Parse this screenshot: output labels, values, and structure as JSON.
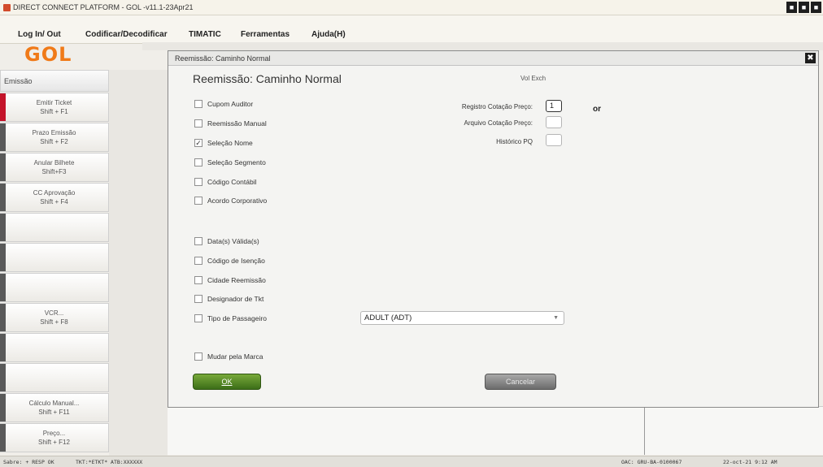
{
  "window": {
    "title": "DIRECT CONNECT PLATFORM - GOL -v11.1-23Apr21",
    "buttons": [
      "■",
      "■",
      "■"
    ]
  },
  "menu": [
    {
      "label": "Log In/ Out"
    },
    {
      "label": "Codificar/Decodificar"
    },
    {
      "label": "TIMATIC"
    },
    {
      "label": "Ferramentas"
    },
    {
      "label": "Ajuda(H)"
    }
  ],
  "logo": "GOL",
  "sidebar": {
    "header": "Emissão",
    "items": [
      {
        "label": "Emitir Ticket",
        "shortcut": "Shift + F1"
      },
      {
        "label": "Prazo Emissão",
        "shortcut": "Shift + F2"
      },
      {
        "label": "Anular Bilhete",
        "shortcut": "Shift+F3"
      },
      {
        "label": "CC Aprovação",
        "shortcut": "Shift + F4"
      },
      {
        "label": "",
        "shortcut": ""
      },
      {
        "label": "",
        "shortcut": ""
      },
      {
        "label": "",
        "shortcut": ""
      },
      {
        "label": "VCR...",
        "shortcut": "Shift + F8"
      },
      {
        "label": "",
        "shortcut": ""
      },
      {
        "label": "",
        "shortcut": ""
      },
      {
        "label": "Cálculo Manual...",
        "shortcut": "Shift + F11"
      },
      {
        "label": "Preço...",
        "shortcut": "Shift + F12"
      }
    ]
  },
  "dialog": {
    "title": "Reemissão: Caminho Normal",
    "heading": "Reemissão: Caminho Normal",
    "vol_exch": "Vol Exch",
    "close": "✖",
    "checkboxes": [
      {
        "label": "Cupom Auditor",
        "checked": false
      },
      {
        "label": "Reemissão Manual",
        "checked": false
      },
      {
        "label": "Seleção Nome",
        "checked": true
      },
      {
        "label": "Seleção Segmento",
        "checked": false
      },
      {
        "label": "Código Contábil",
        "checked": false
      },
      {
        "label": "Acordo Corporativo",
        "checked": false
      },
      {
        "label": "Data(s) Válida(s)",
        "checked": false
      },
      {
        "label": "Código de Isenção",
        "checked": false
      },
      {
        "label": "Cidade Reemissão",
        "checked": false
      },
      {
        "label": "Designador de Tkt",
        "checked": false
      },
      {
        "label": "Tipo de Passageiro",
        "checked": false
      },
      {
        "label": "Mudar pela Marca",
        "checked": false
      }
    ],
    "check_mark": "✓",
    "fields": [
      {
        "label": "Registro Cotação Preço:",
        "value": "1"
      },
      {
        "label": "Arquivo Cotação Preço:",
        "value": ""
      },
      {
        "label": "Histórico PQ",
        "value": ""
      }
    ],
    "or_label": "or",
    "passenger_type": "ADULT (ADT)",
    "ok_label": "OK",
    "cancel_label": "Cancelar"
  },
  "status": {
    "left": "Sabre: + RESP OK",
    "tkt": "TKT:*ETKT* ATB:XXXXXX",
    "oac": "OAC: GRU-BA-0100067",
    "datetime": "22-oct-21 9:12 AM"
  }
}
